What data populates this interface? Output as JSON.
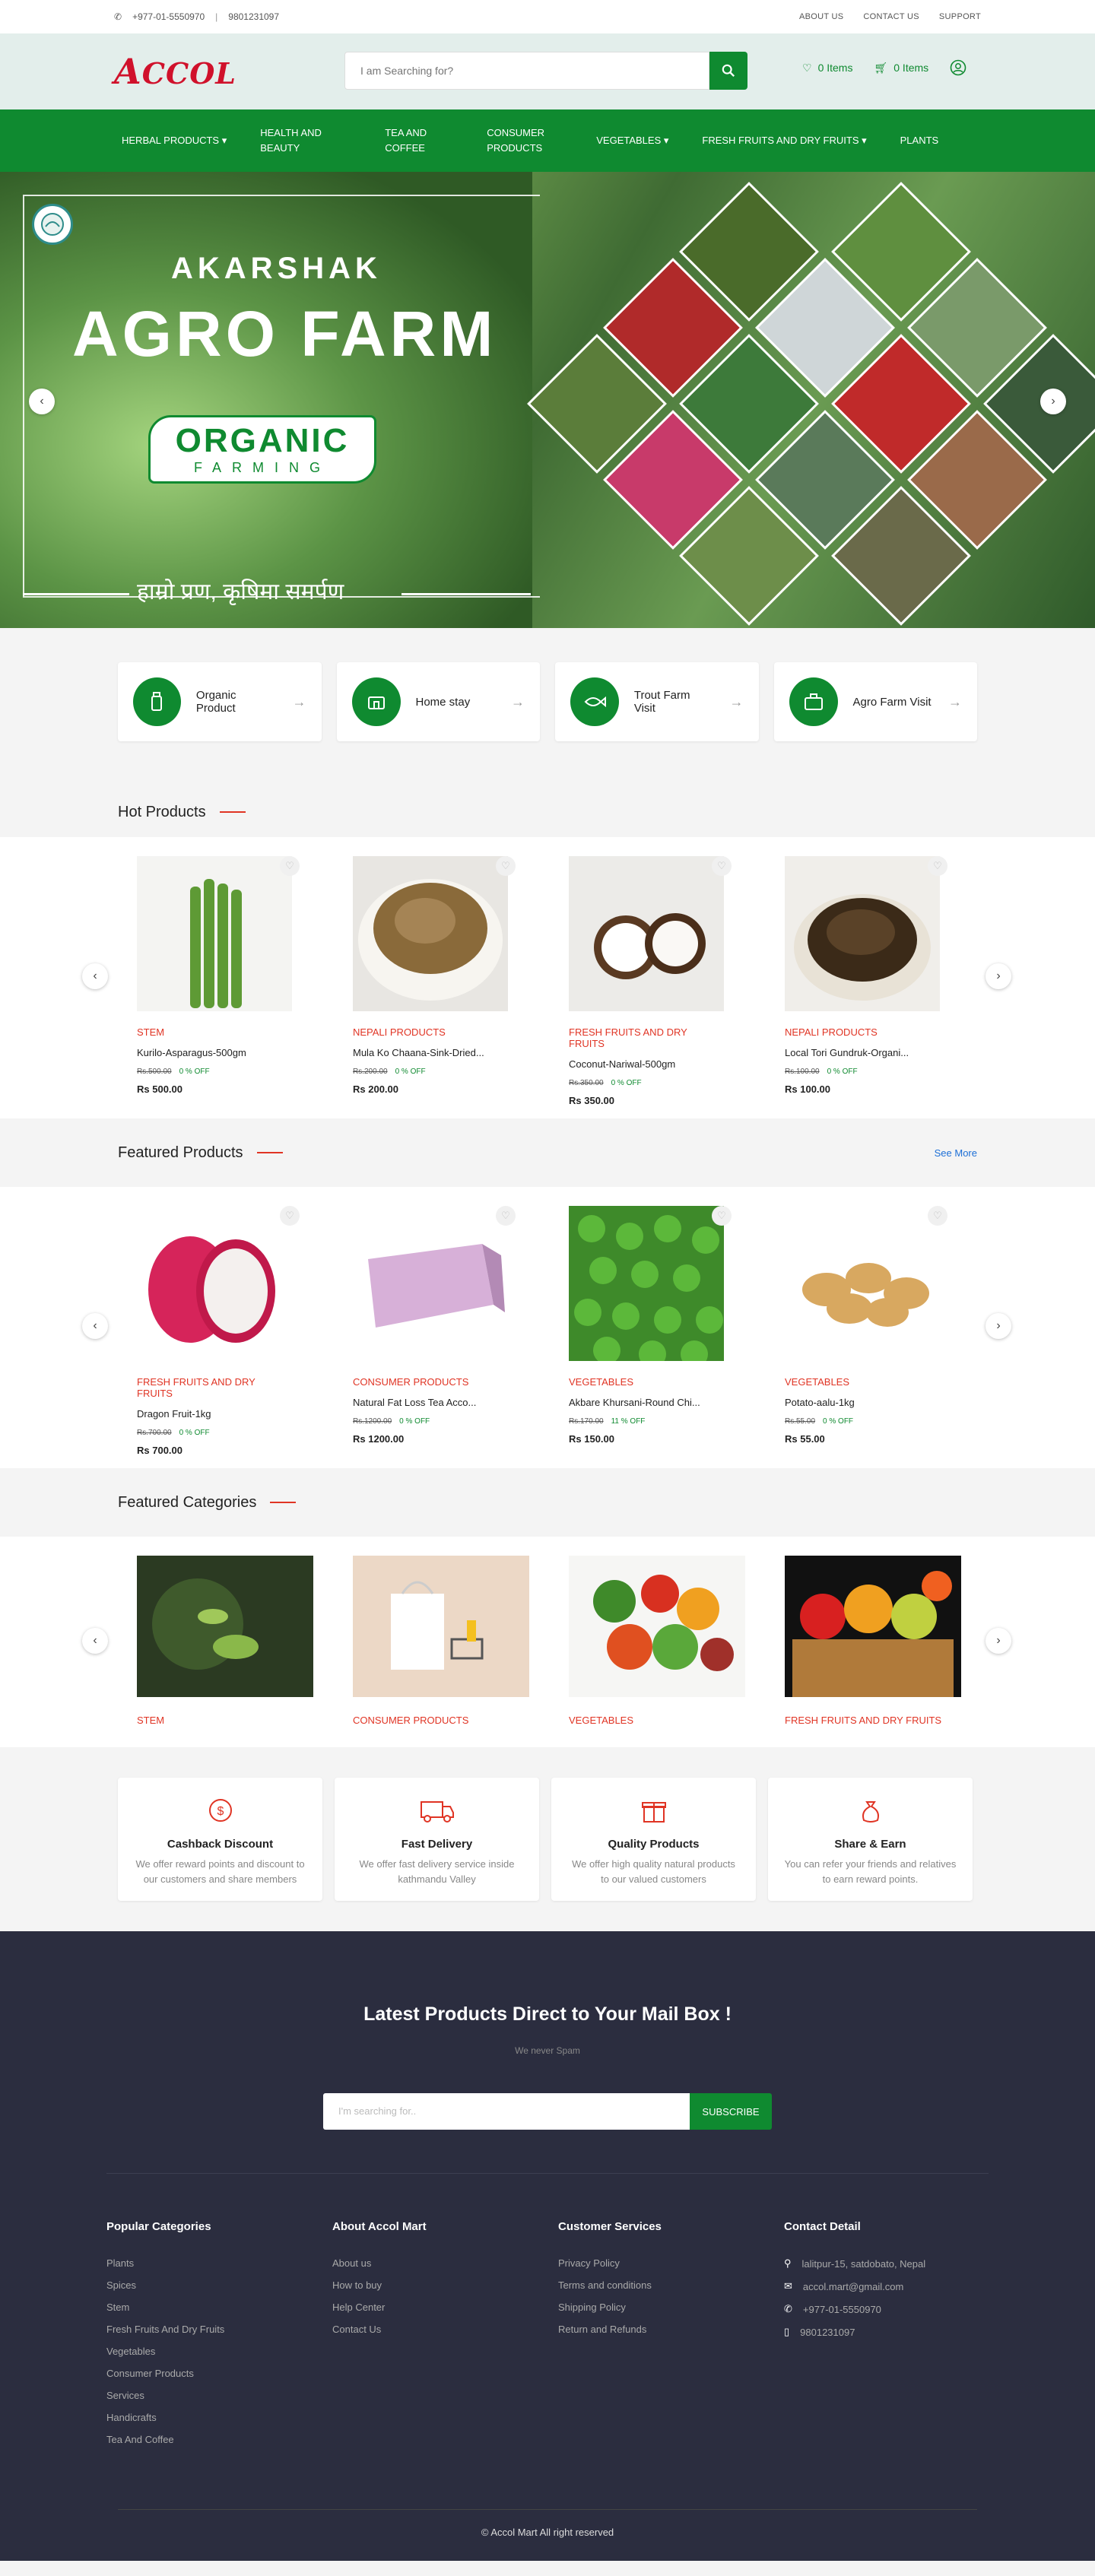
{
  "topbar": {
    "phone": "+977-01-5550970",
    "mobile": "9801231097",
    "links": [
      "ABOUT US",
      "CONTACT US",
      "SUPPORT"
    ]
  },
  "header": {
    "logo_a": "A",
    "logo_rest": "CCOL",
    "search_placeholder": "I am Searching for?",
    "wishlist": "0 Items",
    "cart": "0 Items"
  },
  "nav": {
    "items": [
      "HERBAL PRODUCTS ▾",
      "HEALTH AND BEAUTY",
      "TEA AND COFFEE",
      "CONSUMER PRODUCTS",
      "VEGETABLES ▾",
      "FRESH FRUITS AND DRY FRUITS ▾",
      "PLANTS"
    ]
  },
  "hero": {
    "subtitle": "AKARSHAK",
    "title": "AGRO FARM",
    "organic": "ORGANIC",
    "farming": "FARMING",
    "tagline": "हाम्रो प्रण, कृषिमा समर्पण"
  },
  "feature_cards": [
    "Organic Product",
    "Home stay",
    "Trout Farm Visit",
    "Agro Farm Visit"
  ],
  "hot": {
    "title": "Hot Products",
    "products": [
      {
        "cat": "STEM",
        "name": "Kurilo-Asparagus-500gm",
        "old": "Rs.500.00",
        "off": "0 % OFF",
        "price": "Rs 500.00"
      },
      {
        "cat": "NEPALI PRODUCTS",
        "name": "Mula Ko Chaana-Sink-Dried...",
        "old": "Rs.200.00",
        "off": "0 % OFF",
        "price": "Rs 200.00"
      },
      {
        "cat": "FRESH FRUITS AND DRY FRUITS",
        "name": "Coconut-Nariwal-500gm",
        "old": "Rs.350.00",
        "off": "0 % OFF",
        "price": "Rs 350.00"
      },
      {
        "cat": "NEPALI PRODUCTS",
        "name": "Local Tori Gundruk-Organi...",
        "old": "Rs.100.00",
        "off": "0 % OFF",
        "price": "Rs 100.00"
      }
    ]
  },
  "featured": {
    "title": "Featured Products",
    "see_more": "See More",
    "products": [
      {
        "cat": "FRESH FRUITS AND DRY FRUITS",
        "name": "Dragon Fruit-1kg",
        "old": "Rs.700.00",
        "off": "0 % OFF",
        "price": "Rs 700.00"
      },
      {
        "cat": "CONSUMER PRODUCTS",
        "name": "Natural Fat Loss Tea Acco...",
        "old": "Rs.1200.00",
        "off": "0 % OFF",
        "price": "Rs 1200.00"
      },
      {
        "cat": "VEGETABLES",
        "name": "Akbare Khursani-Round Chi...",
        "old": "Rs.170.00",
        "off": "11 % OFF",
        "price": "Rs 150.00"
      },
      {
        "cat": "VEGETABLES",
        "name": "Potato-aalu-1kg",
        "old": "Rs.55.00",
        "off": "0 % OFF",
        "price": "Rs 55.00"
      }
    ]
  },
  "categories": {
    "title": "Featured Categories",
    "items": [
      "STEM",
      "CONSUMER PRODUCTS",
      "VEGETABLES",
      "FRESH FRUITS AND DRY FRUITS"
    ]
  },
  "services": [
    {
      "t": "Cashback Discount",
      "d": "We offer reward points and discount to our customers and share members"
    },
    {
      "t": "Fast Delivery",
      "d": "We offer fast delivery service inside kathmandu Valley"
    },
    {
      "t": "Quality Products",
      "d": "We offer high quality natural products to our valued customers"
    },
    {
      "t": "Share & Earn",
      "d": "You can refer your friends and relatives to earn reward points."
    }
  ],
  "newsletter": {
    "title": "Latest Products Direct to Your Mail Box !",
    "sub": "We never Spam",
    "placeholder": "I'm searching for..",
    "btn": "SUBSCRIBE"
  },
  "footer": {
    "c1": {
      "h": "Popular Categories",
      "items": [
        "Plants",
        "Spices",
        "Stem",
        "Fresh Fruits And Dry Fruits",
        "Vegetables",
        "Consumer Products",
        "Services",
        "Handicrafts",
        "Tea And Coffee"
      ]
    },
    "c2": {
      "h": "About Accol Mart",
      "items": [
        "About us",
        "How to buy",
        "Help Center",
        "Contact Us"
      ]
    },
    "c3": {
      "h": "Customer Services",
      "items": [
        "Privacy Policy",
        "Terms and conditions",
        "Shipping Policy",
        "Return and Refunds"
      ]
    },
    "c4": {
      "h": "Contact Detail",
      "items": [
        "lalitpur-15, satdobato, Nepal",
        "accol.mart@gmail.com",
        "+977-01-5550970",
        "9801231097"
      ]
    },
    "copy": "© Accol Mart All right reserved"
  }
}
